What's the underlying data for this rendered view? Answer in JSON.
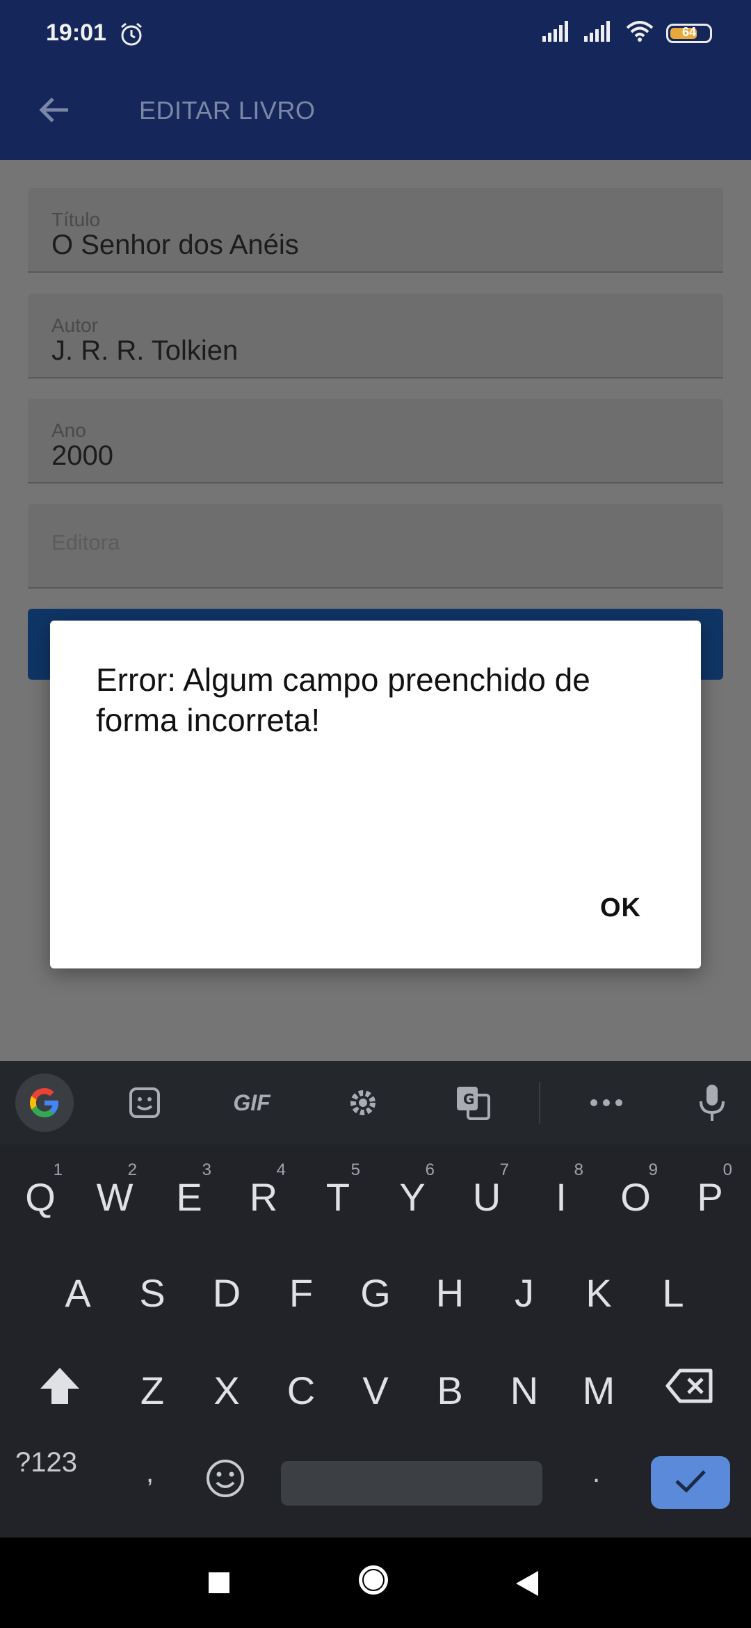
{
  "status_bar": {
    "time": "19:01",
    "battery": "64"
  },
  "app_bar": {
    "title": "EDITAR LIVRO"
  },
  "form": {
    "titulo": {
      "label": "Título",
      "value": "O Senhor dos Anéis"
    },
    "autor": {
      "label": "Autor",
      "value": "J. R. R. Tolkien"
    },
    "ano": {
      "label": "Ano",
      "value": "2000"
    },
    "editora": {
      "placeholder": "Editora"
    }
  },
  "dialog": {
    "message": "Error: Algum campo preenchido de forma incorreta!",
    "ok_label": "OK"
  },
  "keyboard": {
    "toolbar": {
      "gif_label": "GIF"
    },
    "row1": [
      {
        "key": "Q",
        "hint": "1"
      },
      {
        "key": "W",
        "hint": "2"
      },
      {
        "key": "E",
        "hint": "3"
      },
      {
        "key": "R",
        "hint": "4"
      },
      {
        "key": "T",
        "hint": "5"
      },
      {
        "key": "Y",
        "hint": "6"
      },
      {
        "key": "U",
        "hint": "7"
      },
      {
        "key": "I",
        "hint": "8"
      },
      {
        "key": "O",
        "hint": "9"
      },
      {
        "key": "P",
        "hint": "0"
      }
    ],
    "row2": [
      "A",
      "S",
      "D",
      "F",
      "G",
      "H",
      "J",
      "K",
      "L"
    ],
    "row3": [
      "Z",
      "X",
      "C",
      "V",
      "B",
      "N",
      "M"
    ],
    "symbols_label": "?123",
    "comma_label": ",",
    "period_label": "."
  },
  "colors": {
    "accent": "#15275a",
    "enter_key": "#5a8ad9",
    "dialog_bg": "#ffffff"
  }
}
